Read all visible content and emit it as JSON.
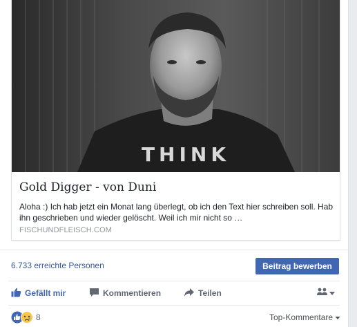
{
  "link_preview": {
    "image_alt": "Bearded man in black shirt",
    "shirt_text": "THINK",
    "title": "Gold Digger - von Duni",
    "description": "Aloha :) Ich hab jetzt ein Monat lang überlegt, ob ich den Text hier schreiben soll. Hab ihn geschrieben und wieder gelöscht. Weil ich mir nicht so …",
    "domain": "FISCHUNDFLEISCH.COM"
  },
  "insights": {
    "reach_text": "6.733 erreichte Personen",
    "boost_label": "Beitrag bewerben"
  },
  "actions": {
    "like_label": "Gefällt mir",
    "comment_label": "Kommentieren",
    "share_label": "Teilen",
    "audience_icon": "friends-icon"
  },
  "reactions": {
    "icons": [
      "like-reaction-icon",
      "sad-reaction-icon"
    ],
    "count": "8",
    "sort_label": "Top-Kommentare"
  },
  "colors": {
    "fb_blue": "#4267b2",
    "link_blue": "#365899",
    "text": "#1d2129",
    "muted": "#90949c"
  }
}
